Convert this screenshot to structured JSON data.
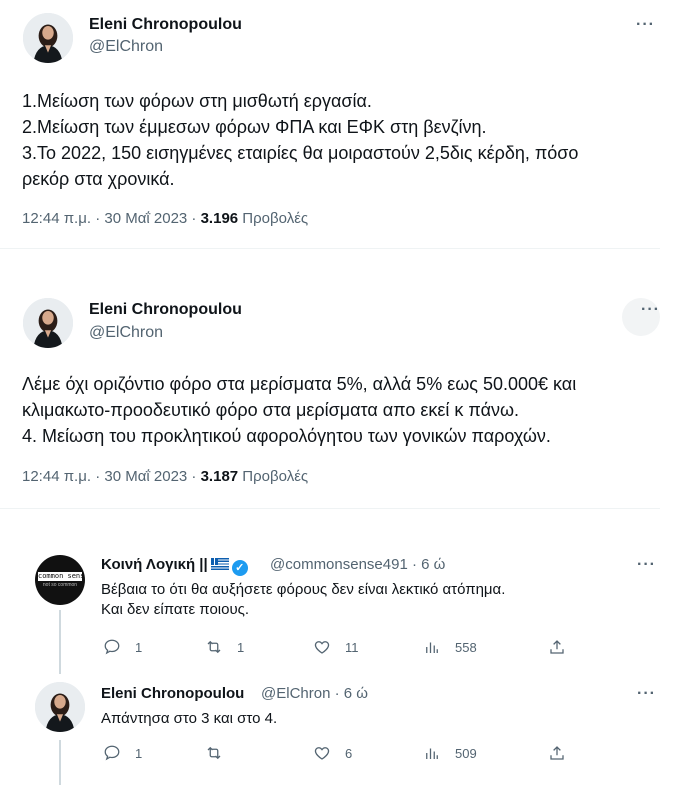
{
  "tweet1": {
    "author_name": "Eleni Chronopoulou",
    "handle": "@ElChron",
    "more_label": "···",
    "lines": [
      "1.Μείωση των φόρων στη μισθωτή εργασία.",
      "2.Μείωση των έμμεσων φόρων ΦΠΑ και ΕΦΚ στη βενζίνη.",
      "3.Το 2022, 150 εισηγμένες εταιρίες θα μοιραστούν 2,5δις κέρδη, πόσο",
      "ρεκόρ στα χρονικά."
    ],
    "timestamp": "12:44 π.μ. · 30 Μαΐ 2023 · ",
    "views_count": "3.196",
    "views_label": " Προβολές"
  },
  "tweet2": {
    "author_name": "Eleni Chronopoulou",
    "handle": "@ElChron",
    "more_label": "···",
    "lines": [
      "Λέμε όχι οριζόντιο φόρο στα μερίσματα 5%, αλλά 5% εως 50.000€ και",
      "κλιμακωτο-προοδευτικό φόρο στα μερίσματα απο εκεί κ πάνω.",
      "4. Μείωση του προκλητικού αφορολόγητου των γονικών παροχών."
    ],
    "timestamp": "12:44 π.μ. · 30 Μαΐ 2023 · ",
    "views_count": "3.187",
    "views_label": " Προβολές"
  },
  "reply1": {
    "author_name": "Κοινή Λογική ||",
    "handle": "@commonsense491 · 6 ώ",
    "avatar_text": "common sense",
    "avatar_subtext": "not so common",
    "more_label": "···",
    "lines": [
      "Βέβαια το ότι θα αυξήσετε φόρους δεν είναι λεκτικό ατόπημα.",
      "Και δεν είπατε ποιους."
    ],
    "actions": {
      "reply": "1",
      "retweet": "1",
      "like": "11",
      "views": "558"
    }
  },
  "reply2": {
    "author_name": "Eleni Chronopoulou",
    "handle": "@ElChron · 6 ώ",
    "more_label": "···",
    "lines": [
      "Απάντησα στο 3 και στο 4."
    ],
    "actions": {
      "reply": "1",
      "retweet": "",
      "like": "6",
      "views": "509"
    }
  },
  "colors": {
    "accent": "#1d9bf0",
    "secondary_text": "#536471",
    "divider": "#eff3f4"
  }
}
